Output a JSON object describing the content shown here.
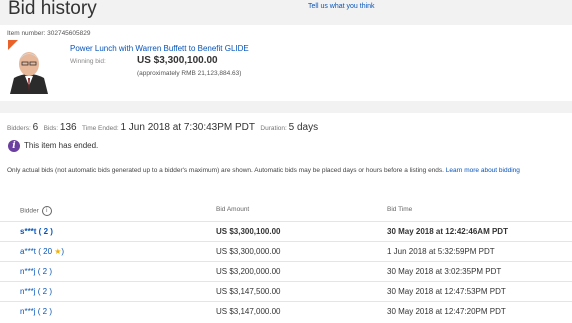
{
  "header": {
    "title": "Bid history",
    "feedback_link": "Tell us what you think"
  },
  "item": {
    "number_label": "Item number:",
    "number": "302745605829",
    "title": "Power Lunch with Warren Buffett to Benefit GLIDE",
    "winning_label": "Winning bid:",
    "winning_amount": "US $3,300,100.00",
    "converted": "(approximately RMB 21,123,884.63)"
  },
  "summary": {
    "bidders_label": "Bidders:",
    "bidders": "6",
    "bids_label": "Bids:",
    "bids": "136",
    "time_ended_label": "Time Ended:",
    "time_ended": "1 Jun 2018 at 7:30:43PM PDT",
    "duration_label": "Duration:",
    "duration": "5 days"
  },
  "notice": {
    "icon": "info-icon",
    "text": "This item has ended."
  },
  "note": {
    "text": "Only actual bids (not automatic bids generated up to a bidder's maximum) are shown. Automatic bids may be placed days or hours before a listing ends.",
    "link": "Learn more about bidding"
  },
  "table": {
    "headers": [
      "Bidder",
      "Bid Amount",
      "Bid Time"
    ],
    "rows": [
      {
        "bidder": "s***t ( 2 )",
        "amount": "US $3,300,100.00",
        "time": "30 May 2018 at 12:42:46AM PDT"
      },
      {
        "bidder": "a***t ( 20 ★)",
        "amount": "US $3,300,000.00",
        "time": "1 Jun 2018 at 5:32:59PM PDT"
      },
      {
        "bidder": "n***j ( 2 )",
        "amount": "US $3,200,000.00",
        "time": "30 May 2018 at 3:02:35PM PDT"
      },
      {
        "bidder": "n***j ( 2 )",
        "amount": "US $3,147,500.00",
        "time": "30 May 2018 at 12:47:53PM PDT"
      },
      {
        "bidder": "n***j ( 2 )",
        "amount": "US $3,147,000.00",
        "time": "30 May 2018 at 12:47:20PM PDT"
      }
    ]
  },
  "colors": {
    "link": "#0654ba",
    "info": "#6b3fa0",
    "star": "#f5af02"
  }
}
